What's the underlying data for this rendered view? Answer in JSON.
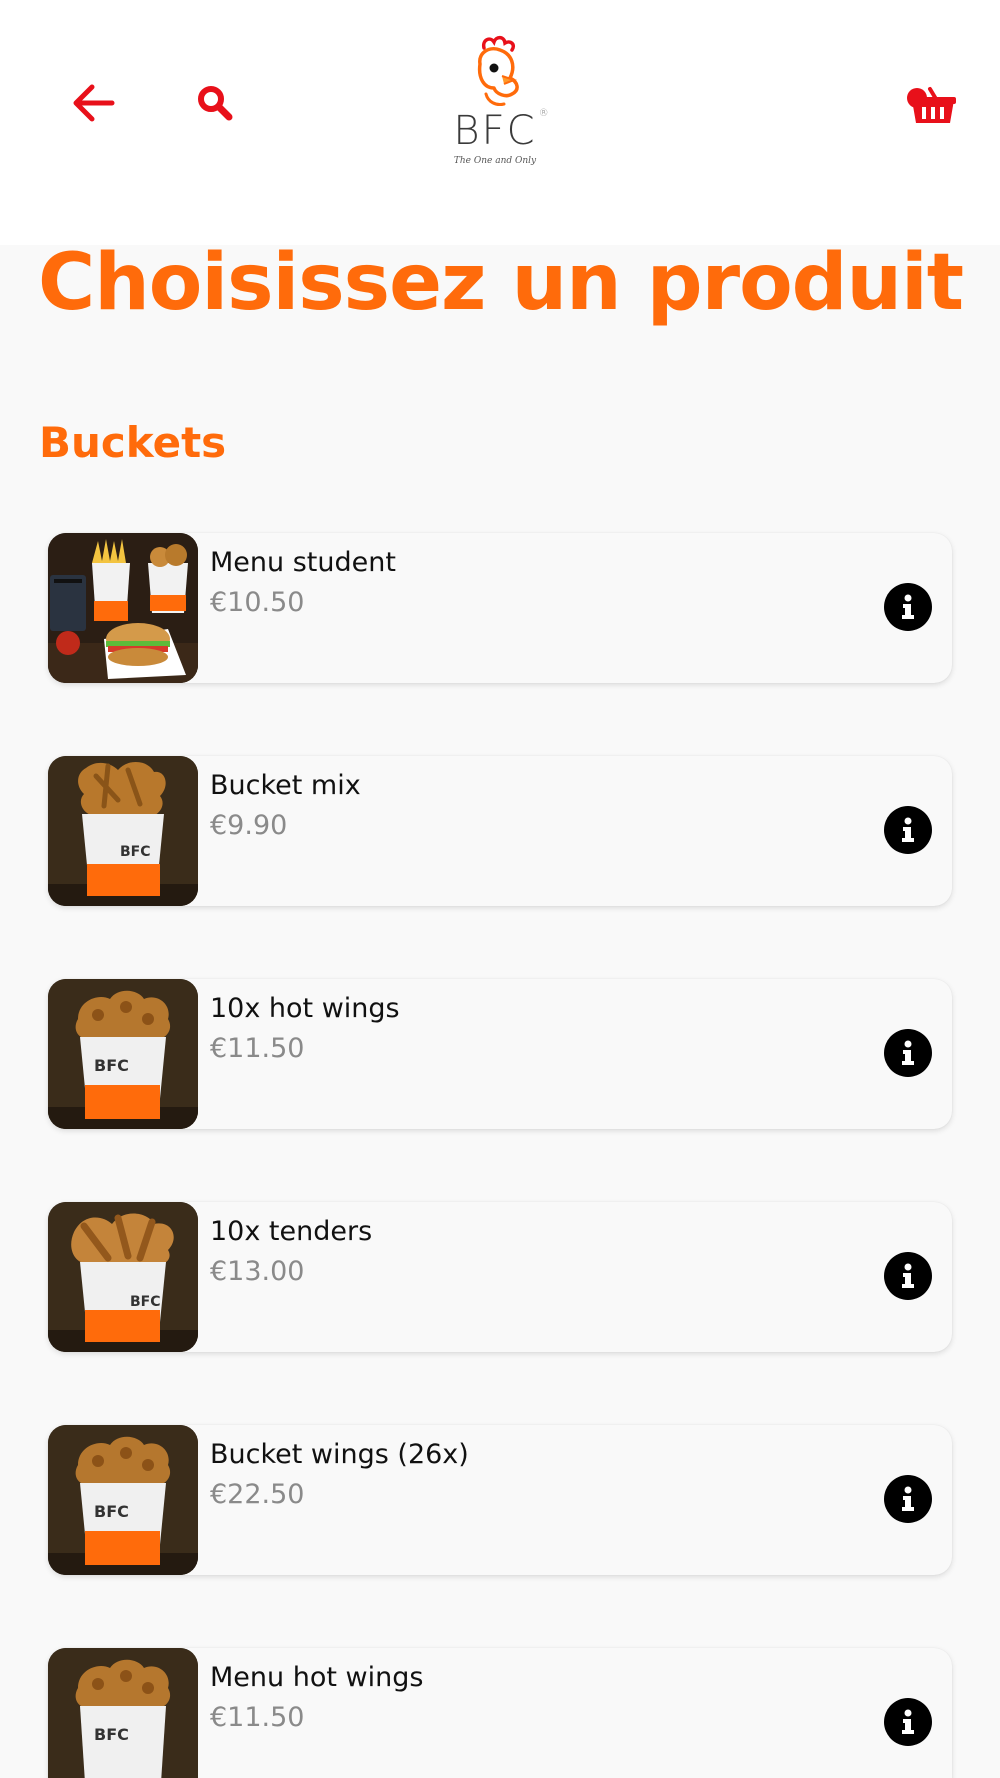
{
  "header": {
    "logo_text": "BFC",
    "logo_reg": "®",
    "logo_tagline": "The One and Only",
    "accent_color": "#e8101a"
  },
  "title": "Choisissez un produit",
  "section": "Buckets",
  "brand_color": "#ff6b0b",
  "products": [
    {
      "name": "Menu student",
      "price": "€10.50",
      "image": "menu-student-image"
    },
    {
      "name": "Bucket mix",
      "price": "€9.90",
      "image": "bucket-mix-image"
    },
    {
      "name": "10x hot wings",
      "price": "€11.50",
      "image": "hot-wings-bucket-image"
    },
    {
      "name": "10x tenders",
      "price": "€13.00",
      "image": "tenders-bucket-image"
    },
    {
      "name": "Bucket wings (26x)",
      "price": "€22.50",
      "image": "wings-bucket-image"
    },
    {
      "name": "Menu hot wings",
      "price": "€11.50",
      "image": "hot-wings-bucket-image"
    }
  ],
  "icons": {
    "back": "arrow-left-icon",
    "search": "magnifier-icon",
    "cart": "basket-icon",
    "info": "info-icon"
  }
}
